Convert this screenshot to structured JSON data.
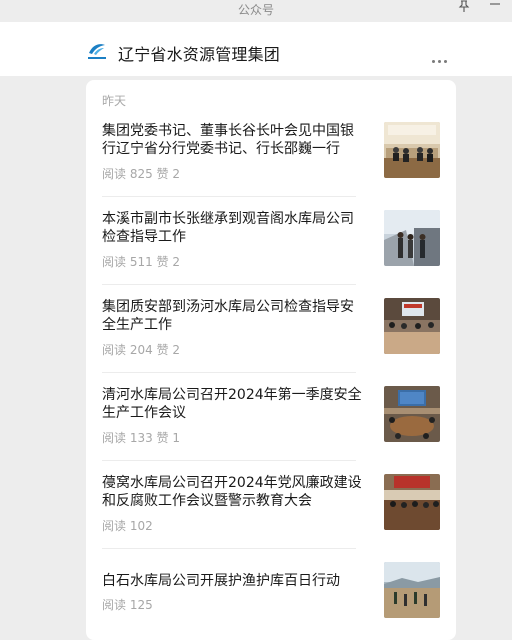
{
  "window": {
    "title": "公众号"
  },
  "account": {
    "name": "辽宁省水资源管理集团"
  },
  "feed": {
    "date_label": "昨天",
    "articles": [
      {
        "title": "集团党委书记、董事长谷长叶会见中国银行辽宁省分行党委书记、行长邵巍一行",
        "reads": "阅读 825",
        "likes": "赞 2"
      },
      {
        "title": "本溪市副市长张继承到观音阁水库局公司检查指导工作",
        "reads": "阅读 511",
        "likes": "赞 2"
      },
      {
        "title": "集团质安部到汤河水库局公司检查指导安全生产工作",
        "reads": "阅读 204",
        "likes": "赞 2"
      },
      {
        "title": "清河水库局公司召开2024年第一季度安全生产工作会议",
        "reads": "阅读 133",
        "likes": "赞 1"
      },
      {
        "title": "葠窝水库局公司召开2024年党风廉政建设和反腐败工作会议暨警示教育大会",
        "reads": "阅读 102",
        "likes": ""
      },
      {
        "title": "白石水库局公司开展护渔护库百日行动",
        "reads": "阅读 125",
        "likes": ""
      }
    ]
  }
}
